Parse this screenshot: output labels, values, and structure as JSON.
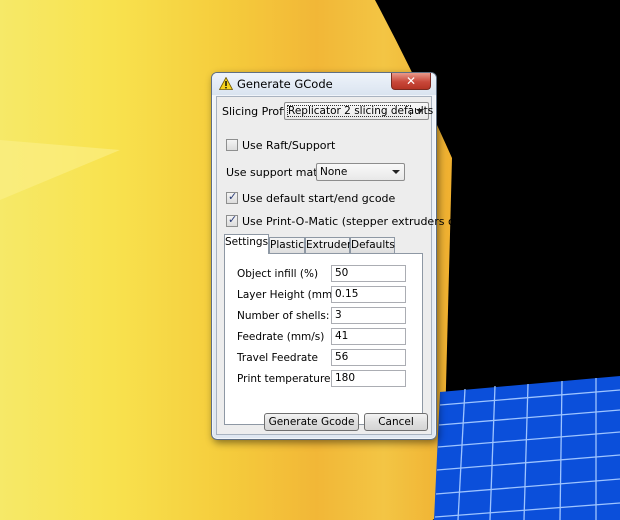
{
  "window": {
    "title": "Generate GCode",
    "close_glyph": "✕",
    "icon": "warning-triangle-icon"
  },
  "profile": {
    "label": "Slicing Profile:",
    "value": "Replicator 2 slicing defaults"
  },
  "raft": {
    "label": "Use Raft/Support",
    "checked": false
  },
  "support": {
    "label": "Use support material",
    "value": "None"
  },
  "default_gcode": {
    "label": "Use default start/end gcode",
    "checked": true
  },
  "print_o_matic": {
    "label": "Use Print-O-Matic (stepper extruders only)",
    "checked": true
  },
  "tabs": [
    {
      "label": "Settings",
      "active": true
    },
    {
      "label": "Plastic",
      "active": false
    },
    {
      "label": "Extruder",
      "active": false
    },
    {
      "label": "Defaults",
      "active": false
    }
  ],
  "settings": [
    {
      "label": "Object infill (%)",
      "value": "50"
    },
    {
      "label": "Layer Height (mm)",
      "value": "0.15"
    },
    {
      "label": "Number of shells:",
      "value": "3"
    },
    {
      "label": "Feedrate (mm/s)",
      "value": "41"
    },
    {
      "label": "Travel Feedrate",
      "value": "56"
    },
    {
      "label": "Print temperature",
      "value": "180"
    }
  ],
  "buttons": {
    "generate": "Generate Gcode",
    "cancel": "Cancel"
  },
  "colors": {
    "object_yellow": "#f7e44a",
    "grid_blue": "#0d4fd8",
    "viewport_bg": "#000000"
  }
}
